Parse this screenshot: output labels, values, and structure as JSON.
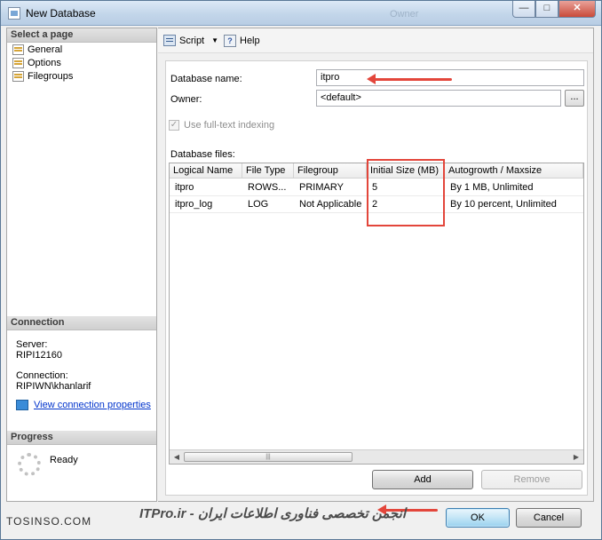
{
  "window": {
    "title": "New Database",
    "ghost_title": "Owner",
    "controls": {
      "minimize": "—",
      "maximize": "□",
      "close": "✕"
    }
  },
  "left_pane": {
    "select_page_header": "Select a page",
    "pages": [
      {
        "label": "General",
        "icon": "page-icon"
      },
      {
        "label": "Options",
        "icon": "page-icon"
      },
      {
        "label": "Filegroups",
        "icon": "page-icon"
      }
    ],
    "connection_header": "Connection",
    "server_label": "Server:",
    "server_value": "RIPI12160",
    "connection_label": "Connection:",
    "connection_value": "RIPIWN\\khanlarif",
    "view_connection_link": "View connection properties",
    "progress_header": "Progress",
    "progress_status": "Ready"
  },
  "toolbar": {
    "script_label": "Script",
    "script_dropdown": "▼",
    "help_label": "Help"
  },
  "general": {
    "database_name_label": "Database name:",
    "database_name_value": "itpro",
    "owner_label": "Owner:",
    "owner_value": "<default>",
    "owner_browse": "...",
    "fulltext_label": "Use full-text indexing",
    "fulltext_checked": "✓",
    "database_files_label": "Database files:"
  },
  "grid": {
    "columns": [
      "Logical Name",
      "File Type",
      "Filegroup",
      "Initial Size (MB)",
      "Autogrowth / Maxsize"
    ],
    "rows": [
      [
        "itpro",
        "ROWS...",
        "PRIMARY",
        "5",
        "By 1 MB, Unlimited"
      ],
      [
        "itpro_log",
        "LOG",
        "Not Applicable",
        "2",
        "By 10 percent, Unlimited"
      ]
    ],
    "scroll_grip": "|||",
    "scroll_left": "◀",
    "scroll_right": "▶"
  },
  "buttons": {
    "add": "Add",
    "remove": "Remove",
    "ok": "OK",
    "cancel": "Cancel"
  },
  "watermark": {
    "left": "TOSINSO.COM",
    "center": "ITPro.ir - انجمن تخصصی فناوری اطلاعات ایران"
  },
  "colors": {
    "highlight": "#e3463b",
    "link": "#0033cc",
    "titlebar": "#c3d6ea"
  }
}
